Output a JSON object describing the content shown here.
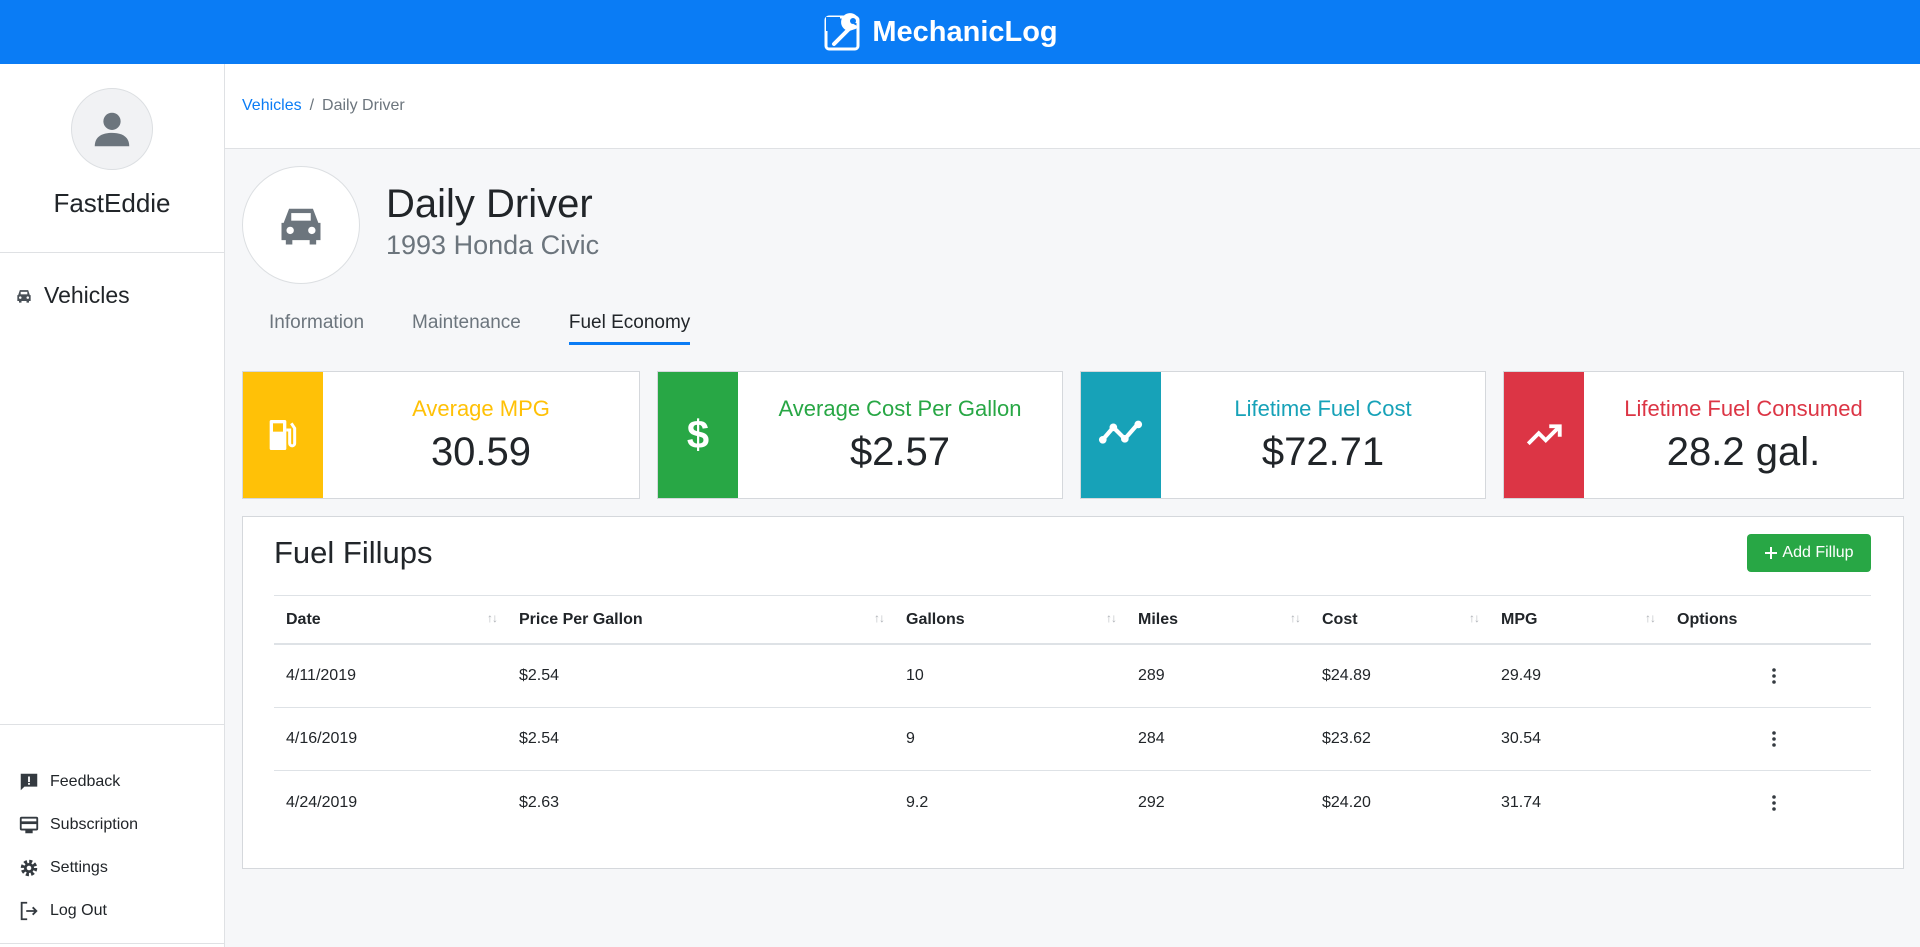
{
  "app": {
    "name": "MechanicLog"
  },
  "user": {
    "username": "FastEddie"
  },
  "sidebar": {
    "nav": [
      {
        "label": "Vehicles",
        "icon": "car-icon"
      }
    ],
    "bottom": [
      {
        "label": "Feedback",
        "icon": "feedback-icon"
      },
      {
        "label": "Subscription",
        "icon": "subscription-icon"
      },
      {
        "label": "Settings",
        "icon": "gear-icon"
      },
      {
        "label": "Log Out",
        "icon": "logout-icon"
      }
    ]
  },
  "breadcrumb": {
    "parent": "Vehicles",
    "separator": "/",
    "current": "Daily Driver"
  },
  "vehicle": {
    "name": "Daily Driver",
    "model": "1993 Honda Civic"
  },
  "tabs": [
    {
      "label": "Information",
      "active": false
    },
    {
      "label": "Maintenance",
      "active": false
    },
    {
      "label": "Fuel Economy",
      "active": true
    }
  ],
  "stats": [
    {
      "label": "Average MPG",
      "value": "30.59",
      "color": "#ffc107",
      "icon": "fuel-pump-icon"
    },
    {
      "label": "Average Cost Per Gallon",
      "value": "$2.57",
      "color": "#28a745",
      "icon": "dollar-icon"
    },
    {
      "label": "Lifetime Fuel Cost",
      "value": "$72.71",
      "color": "#17a2b8",
      "icon": "line-chart-icon"
    },
    {
      "label": "Lifetime Fuel Consumed",
      "value": "28.2 gal.",
      "color": "#dc3545",
      "icon": "trending-up-icon"
    }
  ],
  "fillups": {
    "title": "Fuel Fillups",
    "add_label": "Add Fillup",
    "columns": [
      "Date",
      "Price Per Gallon",
      "Gallons",
      "Miles",
      "Cost",
      "MPG",
      "Options"
    ],
    "rows": [
      [
        "4/11/2019",
        "$2.54",
        "10",
        "289",
        "$24.89",
        "29.49"
      ],
      [
        "4/16/2019",
        "$2.54",
        "9",
        "284",
        "$23.62",
        "30.54"
      ],
      [
        "4/24/2019",
        "$2.63",
        "9.2",
        "292",
        "$24.20",
        "31.74"
      ]
    ],
    "sort_glyph": "↑↓"
  },
  "colors": {
    "primary": "#0a7cf5",
    "success": "#28a745"
  }
}
